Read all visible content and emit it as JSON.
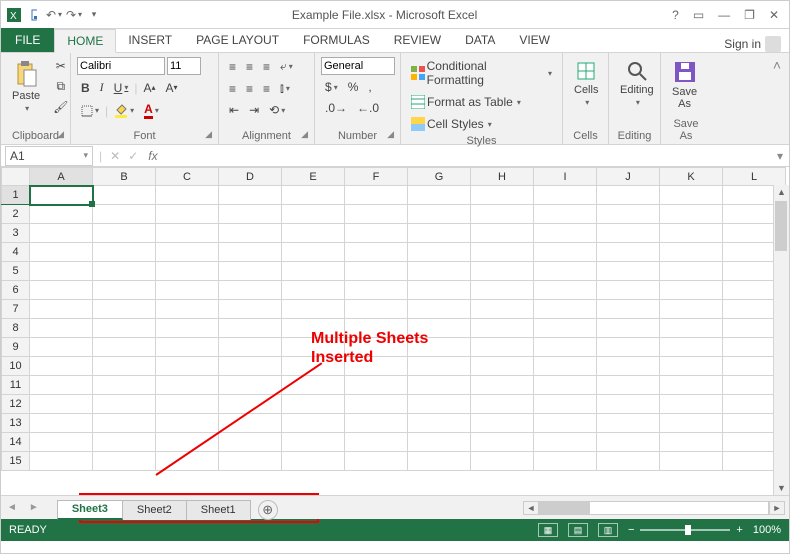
{
  "window_title": "Example File.xlsx - Microsoft Excel",
  "sign_in": "Sign in",
  "tabs": {
    "file": "FILE",
    "list": [
      "HOME",
      "INSERT",
      "PAGE LAYOUT",
      "FORMULAS",
      "REVIEW",
      "DATA",
      "VIEW"
    ],
    "active": "HOME"
  },
  "ribbon": {
    "clipboard": {
      "label": "Clipboard",
      "paste": "Paste"
    },
    "font": {
      "label": "Font",
      "name": "Calibri",
      "size": "11",
      "bold": "B",
      "italic": "I",
      "underline": "U"
    },
    "alignment": {
      "label": "Alignment"
    },
    "number": {
      "label": "Number",
      "format": "General"
    },
    "styles": {
      "label": "Styles",
      "cond": "Conditional Formatting",
      "table": "Format as Table",
      "cell": "Cell Styles"
    },
    "cells": {
      "label": "Cells",
      "btn": "Cells"
    },
    "editing": {
      "label": "Editing",
      "btn": "Editing"
    },
    "save": {
      "label": "Save As",
      "btn1": "Save",
      "btn2": "As"
    }
  },
  "namebox": "A1",
  "fx_label": "fx",
  "columns": [
    "A",
    "B",
    "C",
    "D",
    "E",
    "F",
    "G",
    "H",
    "I",
    "J",
    "K",
    "L"
  ],
  "rows": [
    "1",
    "2",
    "3",
    "4",
    "5",
    "6",
    "7",
    "8",
    "9",
    "10",
    "11",
    "12",
    "13",
    "14",
    "15"
  ],
  "active_cell": {
    "row": "1",
    "col": "A"
  },
  "sheets": [
    "Sheet3",
    "Sheet2",
    "Sheet1"
  ],
  "active_sheet": "Sheet3",
  "annotation": {
    "line1": "Multiple Sheets",
    "line2": "Inserted"
  },
  "status": {
    "ready": "READY",
    "zoom": "100%"
  }
}
